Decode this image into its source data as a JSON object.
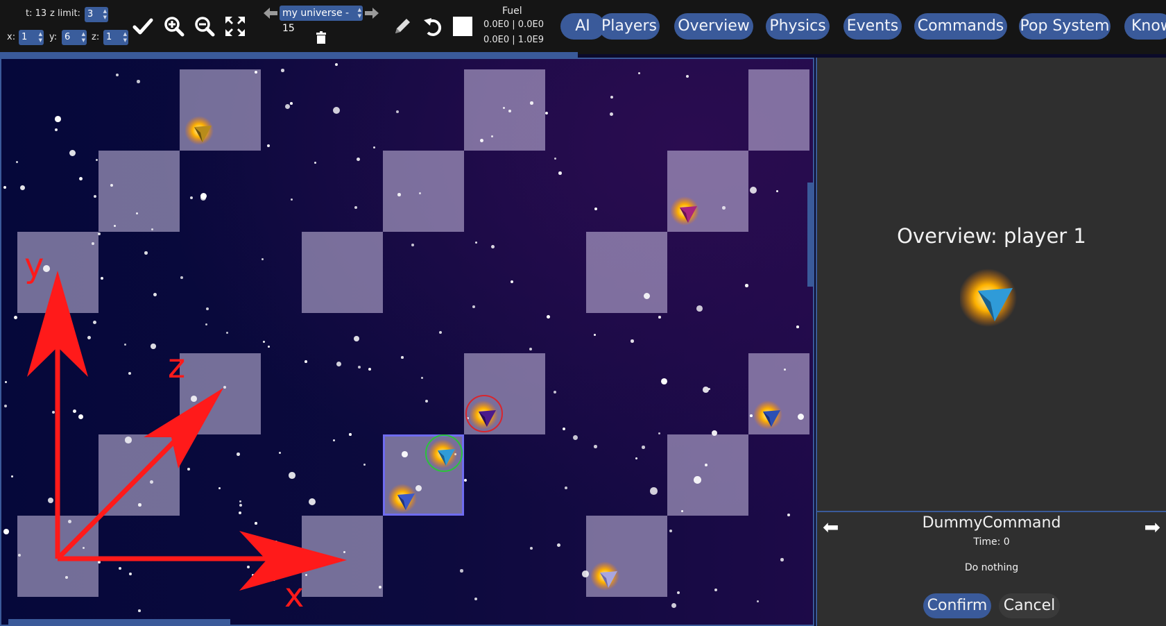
{
  "toolbar": {
    "t_label": "t: 13",
    "zlimit_label": "z limit:",
    "zlimit_value": "3",
    "x_label": "x:",
    "x_value": "1",
    "y_label": "y:",
    "y_value": "6",
    "z_label": "z:",
    "z_value": "1",
    "universe_select": "my universe - 15",
    "fuel_label": "Fuel",
    "fuel_line1": "0.0E0 | 0.0E0",
    "fuel_line2": "0.0E0 | 1.0E9",
    "icons": [
      "checkmark-icon",
      "zoom-in-icon",
      "zoom-out-icon",
      "fit-view-icon",
      "prev-arrow-icon",
      "next-arrow-icon",
      "trash-icon",
      "pencil-icon",
      "undo-icon",
      "stop-icon"
    ]
  },
  "nav": {
    "ai": "AI",
    "players": "Players",
    "overview": "Overview",
    "physics": "Physics",
    "events": "Events",
    "commands": "Commands",
    "pop_system": "Pop System",
    "knowledge": "Know"
  },
  "canvas": {
    "axis_x": "x",
    "axis_y": "y",
    "axis_z": "z",
    "colors": {
      "tile": "#cdc3e6",
      "axis": "#ff1a1a",
      "selection": "#6f6cf0",
      "ring_red": "#d8262e",
      "ring_green": "#2bc33b"
    }
  },
  "side_panel": {
    "overview_title": "Overview: player 1",
    "player_ship_color": "#2f9bd8",
    "command": {
      "name": "DummyCommand",
      "time": "Time: 0",
      "description": "Do nothing"
    },
    "confirm_label": "Confirm",
    "cancel_label": "Cancel"
  },
  "colors": {
    "accent": "#3a5a9a",
    "toolbar_bg": "#151515",
    "panel_bg": "#2f2f2f"
  }
}
